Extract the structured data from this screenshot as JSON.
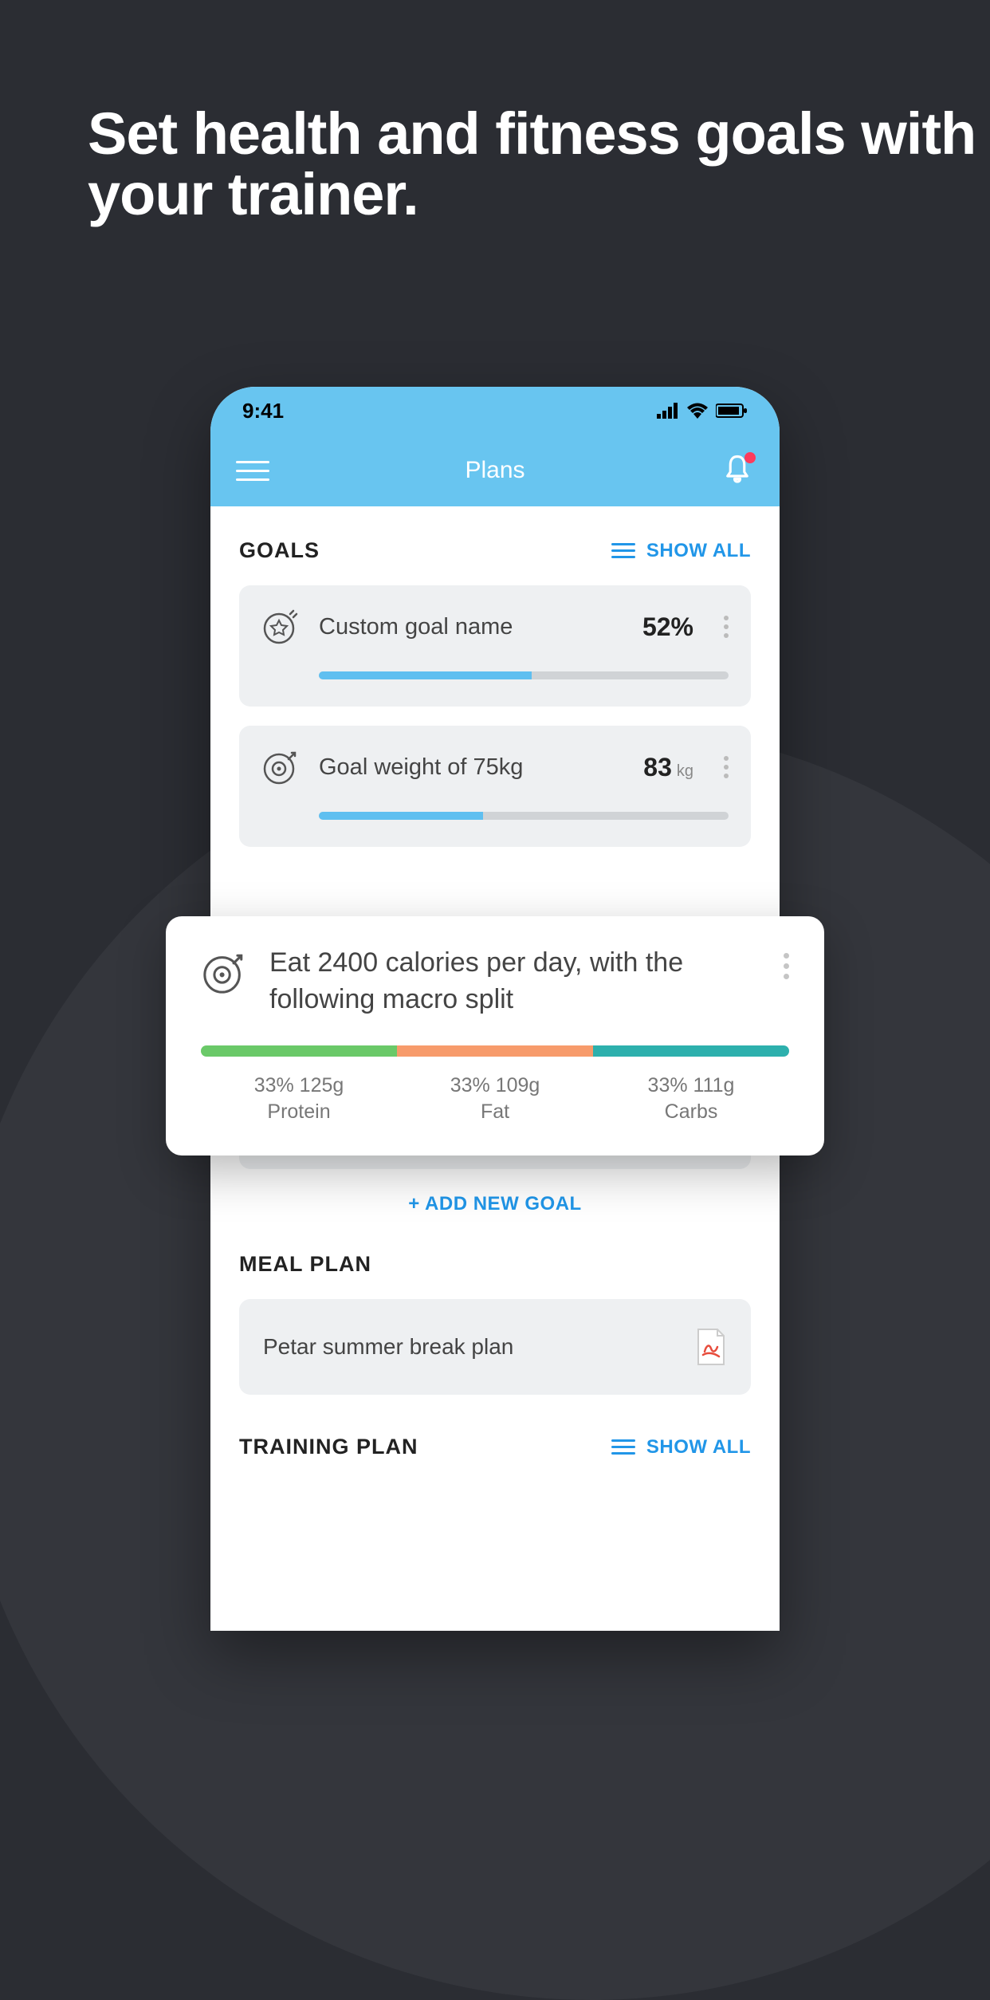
{
  "promo": {
    "headline": "Set health and fitness goals with your trainer."
  },
  "statusBar": {
    "time": "9:41"
  },
  "nav": {
    "title": "Plans"
  },
  "sections": {
    "goals": {
      "title": "GOALS",
      "showAll": "SHOW ALL"
    },
    "mealPlan": {
      "title": "MEAL PLAN"
    },
    "trainingPlan": {
      "title": "TRAINING PLAN",
      "showAll": "SHOW ALL"
    }
  },
  "goals": [
    {
      "name": "Custom goal name",
      "value": "52%",
      "unit": "",
      "progress": 52
    },
    {
      "name": "Goal weight of 75kg",
      "value": "83",
      "unit": "kg",
      "progress": 40
    }
  ],
  "macroGoal": {
    "title": "Eat 2400 calories per day, with the following macro split",
    "segments": [
      {
        "pct": 33,
        "grams": "125g",
        "label": "Protein",
        "stat": "33% 125g"
      },
      {
        "pct": 33,
        "grams": "109g",
        "label": "Fat",
        "stat": "33% 109g"
      },
      {
        "pct": 33,
        "grams": "111g",
        "label": "Carbs",
        "stat": "33% 111g"
      }
    ]
  },
  "simpleGoal": {
    "name": "Eat 2400 calories per day"
  },
  "addGoal": {
    "label": "+ ADD NEW GOAL"
  },
  "mealPlan": {
    "name": "Petar summer break plan"
  }
}
